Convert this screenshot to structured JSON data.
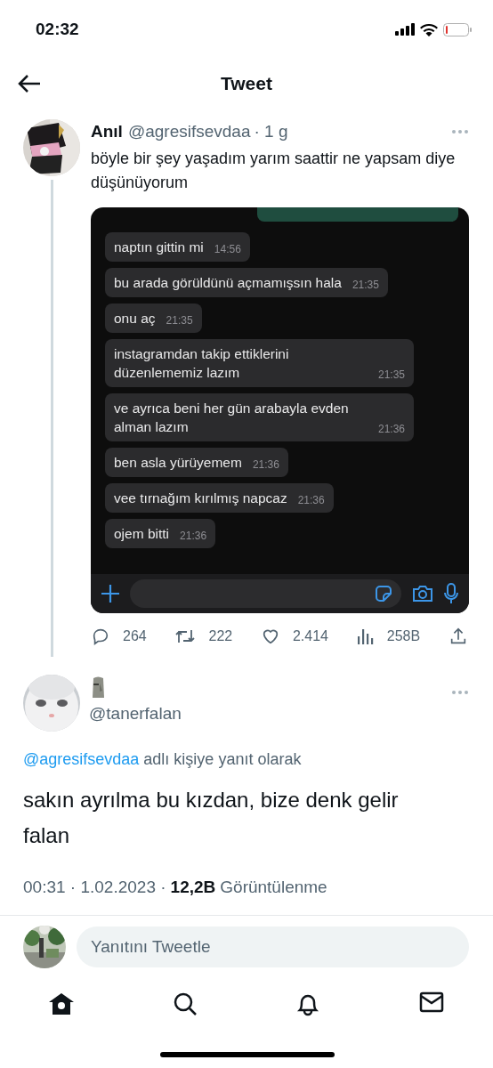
{
  "status_bar": {
    "time": "02:32"
  },
  "header": {
    "title": "Tweet"
  },
  "tweet": {
    "name": "Anıl",
    "handle": "@agresifsevdaa",
    "age": "· 1 g",
    "text": "böyle bir şey yaşadım yarım saattir ne yapsam diye düşünüyorum",
    "chat": {
      "messages": [
        {
          "text": "naptın gittin mi",
          "time": "14:56"
        },
        {
          "text": "bu arada görüldünü açmamışsın hala",
          "time": "21:35"
        },
        {
          "text": "onu aç",
          "time": "21:35"
        },
        {
          "text": "instagramdan takip ettiklerini düzenlememiz lazım",
          "time": "21:35"
        },
        {
          "text": "ve ayrıca beni her gün arabayla evden alman lazım",
          "time": "21:36"
        },
        {
          "text": "ben asla yürüyemem",
          "time": "21:36"
        },
        {
          "text": "vee tırnağım kırılmış napcaz",
          "time": "21:36"
        },
        {
          "text": "ojem bitti",
          "time": "21:36"
        }
      ]
    },
    "actions": [
      {
        "kind": "reply",
        "count": "264"
      },
      {
        "kind": "retweet",
        "count": "222"
      },
      {
        "kind": "like",
        "count": "2.414"
      },
      {
        "kind": "views",
        "count": "258B"
      },
      {
        "kind": "share"
      }
    ]
  },
  "reply": {
    "handle": "@tanerfalan",
    "mention": "@agresifsevdaa",
    "reply_note": "adlı kişiye yanıt olarak",
    "text": "sakın ayrılma bu kızdan, bize denk gelir falan",
    "time": "00:31 · 1.02.2023 ·",
    "views": "12,2B",
    "views_label": "Görüntülenme"
  },
  "composer": {
    "placeholder": "Yanıtını Tweetle"
  },
  "tab_bar": [
    {
      "kind": "home",
      "selected": true
    },
    {
      "kind": "search",
      "selected": false
    },
    {
      "kind": "notifications",
      "selected": false
    },
    {
      "kind": "messages",
      "selected": false
    }
  ]
}
